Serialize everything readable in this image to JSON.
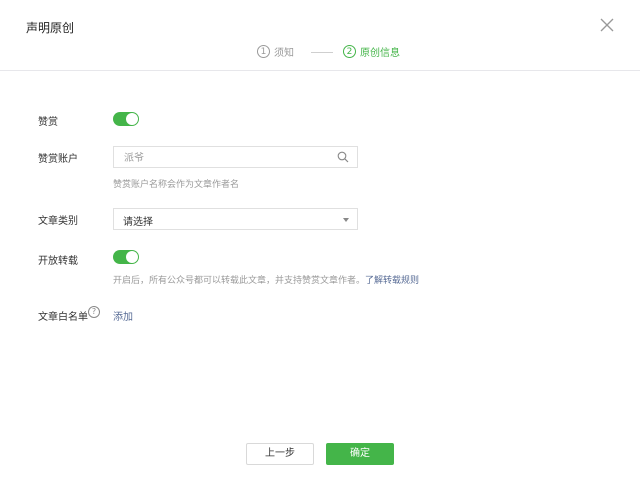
{
  "dialog": {
    "title": "声明原创",
    "close_icon": "close-icon"
  },
  "steps": [
    {
      "number": "1",
      "label": "须知",
      "active": false
    },
    {
      "number": "2",
      "label": "原创信息",
      "active": true
    }
  ],
  "form": {
    "reward": {
      "label": "赞赏",
      "enabled": true
    },
    "reward_account": {
      "label": "赞赏账户",
      "placeholder": "派爷",
      "value": "",
      "search_icon": "search-icon",
      "help": "赞赏账户名称会作为文章作者名"
    },
    "category": {
      "label": "文章类别",
      "selected": "请选择"
    },
    "reprint": {
      "label": "开放转载",
      "enabled": true,
      "help": "开启后，所有公众号都可以转载此文章，并支持赞赏文章作者。",
      "help_link": "了解转载规则"
    },
    "whitelist": {
      "label": "文章白名单",
      "help_icon": "?",
      "add_label": "添加"
    }
  },
  "footer": {
    "prev_label": "上一步",
    "confirm_label": "确定"
  },
  "colors": {
    "accent": "#44b549",
    "link": "#576b95",
    "muted": "#9a9a9a"
  }
}
